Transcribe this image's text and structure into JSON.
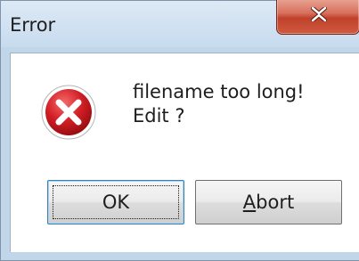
{
  "window": {
    "title": "Error",
    "close_glyph": "x"
  },
  "message": {
    "line1": "filename too long!",
    "line2": "Edit ?"
  },
  "icon": {
    "name": "error-icon",
    "color": "#c8171f"
  },
  "buttons": {
    "ok_label": "OK",
    "abort_label": "Abort"
  }
}
